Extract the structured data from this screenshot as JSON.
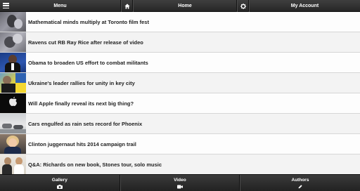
{
  "topbar": {
    "menu_label": "Menu",
    "home_label": "Home",
    "account_label": "My Account",
    "icons": [
      "menu-icon",
      "home-icon",
      "gear-icon"
    ]
  },
  "articles": [
    {
      "title": "Mathematical minds multiply at Toronto film fest"
    },
    {
      "title": "Ravens cut RB Ray Rice after release of video"
    },
    {
      "title": "Obama to broaden US effort to combat militants"
    },
    {
      "title": "Ukraine's leader rallies for unity in key city"
    },
    {
      "title": "Will Apple finally reveal its next big thing?"
    },
    {
      "title": "Cars engulfed as rain sets record for Phoenix"
    },
    {
      "title": "Clinton juggernaut hits 2014 campaign trail"
    },
    {
      "title": "Q&A: Richards on new book, Stones tour, solo music"
    }
  ],
  "bottombar": {
    "gallery_label": "Gallery",
    "video_label": "Video",
    "authors_label": "Authors",
    "icons": [
      "camera-icon",
      "video-camera-icon",
      "pencil-icon"
    ]
  }
}
